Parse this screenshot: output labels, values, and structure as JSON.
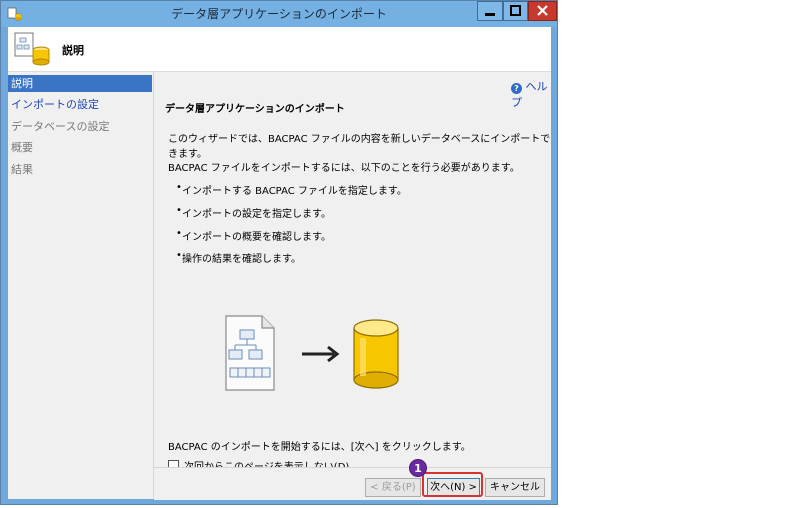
{
  "window": {
    "title": "データ層アプリケーションのインポート"
  },
  "header": {
    "title": "説明"
  },
  "sidebar": {
    "items": [
      {
        "label": "説明",
        "state": "active"
      },
      {
        "label": "インポートの設定",
        "state": "link"
      },
      {
        "label": "データベースの設定",
        "state": "disabled"
      },
      {
        "label": "概要",
        "state": "disabled"
      },
      {
        "label": "結果",
        "state": "disabled"
      }
    ]
  },
  "main": {
    "help_label": "ヘルプ",
    "heading": "データ層アプリケーションのインポート",
    "intro": "このウィザードでは、BACPAC ファイルの内容を新しいデータベースにインポートできます。",
    "steps_intro": "BACPAC ファイルをインポートするには、以下のことを行う必要があります。",
    "steps": [
      "インポートする BACPAC ファイルを指定します。",
      "インポートの設定を指定します。",
      "インポートの概要を確認します。",
      "操作の結果を確認します。"
    ],
    "start_text": "BACPAC のインポートを開始するには、[次へ] をクリックします。",
    "checkbox_label": "次回からこのページを表示しない(D)",
    "checkbox_checked": false
  },
  "footer": {
    "back_label": "< 戻る(P)",
    "next_label": "次へ(N) >",
    "cancel_label": "キャンセル"
  },
  "annotation": {
    "badge_number": "1"
  },
  "colors": {
    "titlebar": "#74b1e2",
    "active_nav": "#3974c5",
    "link": "#1d45b8",
    "highlight": "#d63333",
    "badge": "#6b2aa0"
  }
}
